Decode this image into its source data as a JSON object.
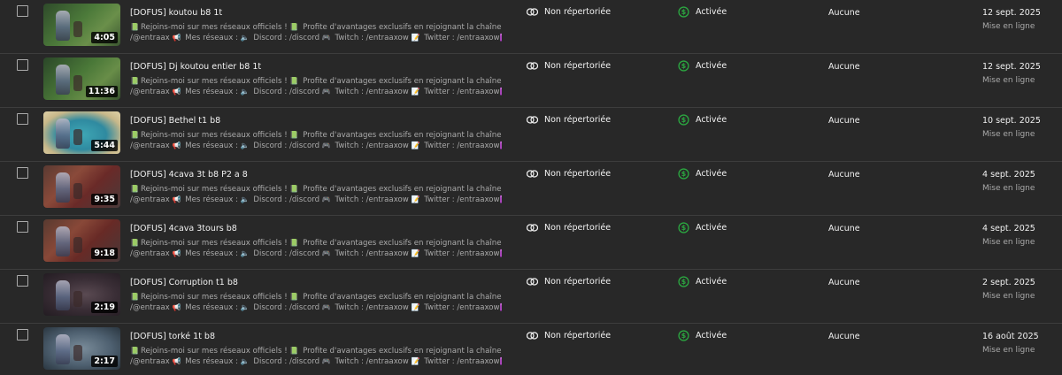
{
  "colors": {
    "background": "#282828",
    "text_primary": "#f1f1f1",
    "text_secondary": "#aaaaaa",
    "monetization_green": "#2ba640"
  },
  "videos": [
    {
      "title": "[DOFUS] koutou b8 1t",
      "duration": "4:05",
      "desc_line1": "Rejoins-moi sur mes réseaux officiels ! ",
      "desc_line1b": " Profite d'avantages exclusifs en rejoignant la chaîne :",
      "desc_line2a": "/@entraax ",
      "desc_line2b": " Mes réseaux : ",
      "desc_line2c": " Discord : /discord ",
      "desc_line2d": " Twitch : /entraaxow ",
      "desc_line2e": " Twitter : /entraaxow",
      "visibility": "Non répertoriée",
      "monetization": "Activée",
      "restrictions": "Aucune",
      "date": "12 sept. 2025",
      "date_label": "Mise en ligne",
      "thumb_bg": "linear-gradient(135deg,#2e4a2a 0%,#4c7a3a 45%,#6a8f4a 70%,#3a5530 100%)"
    },
    {
      "title": "[DOFUS] Dj koutou entier b8 1t",
      "duration": "11:36",
      "desc_line1": "Rejoins-moi sur mes réseaux officiels ! ",
      "desc_line1b": " Profite d'avantages exclusifs en rejoignant la chaîne :",
      "desc_line2a": "/@entraax ",
      "desc_line2b": " Mes réseaux : ",
      "desc_line2c": " Discord : /discord ",
      "desc_line2d": " Twitch : /entraaxow ",
      "desc_line2e": " Twitter : /entraaxow",
      "visibility": "Non répertoriée",
      "monetization": "Activée",
      "restrictions": "Aucune",
      "date": "12 sept. 2025",
      "date_label": "Mise en ligne",
      "thumb_bg": "linear-gradient(135deg,#2a4628 0%,#4a7838 45%,#688d48 70%,#37532e 100%)"
    },
    {
      "title": "[DOFUS] Bethel t1 b8",
      "duration": "5:44",
      "desc_line1": "Rejoins-moi sur mes réseaux officiels ! ",
      "desc_line1b": " Profite d'avantages exclusifs en rejoignant la chaîne :",
      "desc_line2a": "/@entraax ",
      "desc_line2b": " Mes réseaux : ",
      "desc_line2c": " Discord : /discord ",
      "desc_line2d": " Twitch : /entraaxow ",
      "desc_line2e": " Twitter : /entraaxow",
      "visibility": "Non répertoriée",
      "monetization": "Activée",
      "restrictions": "Aucune",
      "date": "10 sept. 2025",
      "date_label": "Mise en ligne",
      "thumb_bg": "radial-gradient(ellipse at 50% 55%,#3fa7b5 0%,#2f8aa0 45%,#c8b88a 75%,#e0d2a8 100%)"
    },
    {
      "title": "[DOFUS] 4cava 3t b8 P2 a 8",
      "duration": "9:35",
      "desc_line1": "Rejoins-moi sur mes réseaux officiels ! ",
      "desc_line1b": " Profite d'avantages exclusifs en rejoignant la chaîne :",
      "desc_line2a": "/@entraax ",
      "desc_line2b": " Mes réseaux : ",
      "desc_line2c": " Discord : /discord ",
      "desc_line2d": " Twitch : /entraaxow ",
      "desc_line2e": " Twitter : /entraaxow",
      "visibility": "Non répertoriée",
      "monetization": "Activée",
      "restrictions": "Aucune",
      "date": "4 sept. 2025",
      "date_label": "Mise en ligne",
      "thumb_bg": "linear-gradient(135deg,#5a3a32 0%,#8a4a3a 35%,#6a2a28 60%,#4a3a3a 100%)"
    },
    {
      "title": "[DOFUS] 4cava 3tours b8",
      "duration": "9:18",
      "desc_line1": "Rejoins-moi sur mes réseaux officiels ! ",
      "desc_line1b": " Profite d'avantages exclusifs en rejoignant la chaîne :",
      "desc_line2a": "/@entraax ",
      "desc_line2b": " Mes réseaux : ",
      "desc_line2c": " Discord : /discord ",
      "desc_line2d": " Twitch : /entraaxow ",
      "desc_line2e": " Twitter : /entraaxow",
      "visibility": "Non répertoriée",
      "monetization": "Activée",
      "restrictions": "Aucune",
      "date": "4 sept. 2025",
      "date_label": "Mise en ligne",
      "thumb_bg": "linear-gradient(135deg,#583a30 0%,#884838 35%,#682a26 60%,#483838 100%)"
    },
    {
      "title": "[DOFUS] Corruption t1 b8",
      "duration": "2:19",
      "desc_line1": "Rejoins-moi sur mes réseaux officiels ! ",
      "desc_line1b": " Profite d'avantages exclusifs en rejoignant la chaîne :",
      "desc_line2a": "/@entraax ",
      "desc_line2b": " Mes réseaux : ",
      "desc_line2c": " Discord : /discord ",
      "desc_line2d": " Twitch : /entraaxow ",
      "desc_line2e": " Twitter : /entraaxow",
      "visibility": "Non répertoriée",
      "monetization": "Activée",
      "restrictions": "Aucune",
      "date": "2 sept. 2025",
      "date_label": "Mise en ligne",
      "thumb_bg": "radial-gradient(ellipse at 55% 50%,#5a4a52 0%,#3a2e36 50%,#231c22 100%)"
    },
    {
      "title": "[DOFUS] torké 1t b8",
      "duration": "2:17",
      "desc_line1": "Rejoins-moi sur mes réseaux officiels ! ",
      "desc_line1b": " Profite d'avantages exclusifs en rejoignant la chaîne :",
      "desc_line2a": "/@entraax ",
      "desc_line2b": " Mes réseaux : ",
      "desc_line2c": " Discord : /discord ",
      "desc_line2d": " Twitch : /entraaxow ",
      "desc_line2e": " Twitter : /entraaxow",
      "visibility": "Non répertoriée",
      "monetization": "Activée",
      "restrictions": "Aucune",
      "date": "16 août 2025",
      "date_label": "Mise en ligne",
      "thumb_bg": "radial-gradient(ellipse at 50% 50%,#7a8c9a 0%,#4e6070 55%,#2a3640 100%)"
    }
  ]
}
